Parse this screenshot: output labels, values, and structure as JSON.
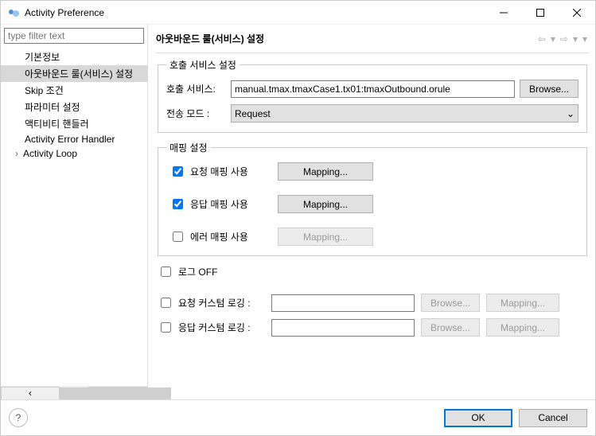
{
  "window": {
    "title": "Activity Preference"
  },
  "sidebar": {
    "filter_placeholder": "type filter text",
    "items": [
      {
        "label": "기본정보",
        "selected": false,
        "expandable": false
      },
      {
        "label": "아웃바운드 룰(서비스) 설정",
        "selected": true,
        "expandable": false
      },
      {
        "label": "Skip 조건",
        "selected": false,
        "expandable": false
      },
      {
        "label": "파라미터 설정",
        "selected": false,
        "expandable": false
      },
      {
        "label": "액티비티 핸들러",
        "selected": false,
        "expandable": false
      },
      {
        "label": "Activity Error Handler",
        "selected": false,
        "expandable": false
      },
      {
        "label": "Activity Loop",
        "selected": false,
        "expandable": true
      }
    ]
  },
  "main": {
    "title": "아웃바운드 룰(서비스) 설정",
    "call_service_section": {
      "legend": "호출 서비스 설정",
      "service_label": "호출 서비스:",
      "service_value": "manual.tmax.tmaxCase1.tx01:tmaxOutbound.orule",
      "browse_label": "Browse...",
      "mode_label": "전송 모드 :",
      "mode_value": "Request"
    },
    "mapping_section": {
      "legend": "매핑 설정",
      "request_label": "요청 매핑 사용",
      "response_label": "응답 매핑 사용",
      "error_label": "에러 매핑 사용",
      "mapping_btn": "Mapping..."
    },
    "log_off_label": "로그 OFF",
    "custom_log": {
      "request_label": "요청 커스텀 로깅 :",
      "response_label": "응답 커스텀 로깅 :",
      "browse_label": "Browse...",
      "mapping_label": "Mapping..."
    }
  },
  "footer": {
    "ok": "OK",
    "cancel": "Cancel"
  }
}
